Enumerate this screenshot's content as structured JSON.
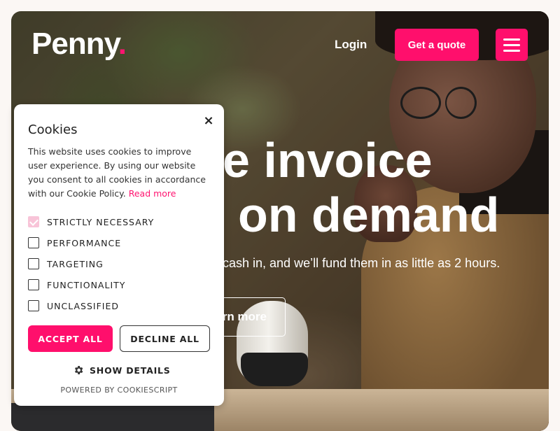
{
  "brand": {
    "name": "Penny",
    "dot": ".",
    "accent": "#ff0f6c"
  },
  "nav": {
    "login": "Login",
    "quote": "Get a quote",
    "menu_icon": "hamburger-icon"
  },
  "hero": {
    "line1": "e invoice",
    "line2": "on demand",
    "subtext": "cash in, and we’ll fund them in as little as 2 hours.",
    "cta": "rn more"
  },
  "cookie": {
    "title": "Cookies",
    "close": "×",
    "text": "This website uses cookies to improve user experience. By using our website you consent to all cookies in accordance with our Cookie Policy.",
    "read_more": "Read more",
    "categories": [
      {
        "label": "STRICTLY NECESSARY",
        "checked": true
      },
      {
        "label": "PERFORMANCE",
        "checked": false
      },
      {
        "label": "TARGETING",
        "checked": false
      },
      {
        "label": "FUNCTIONALITY",
        "checked": false
      },
      {
        "label": "UNCLASSIFIED",
        "checked": false
      }
    ],
    "accept": "ACCEPT ALL",
    "decline": "DECLINE ALL",
    "details": "SHOW DETAILS",
    "powered": "POWERED BY COOKIESCRIPT"
  }
}
